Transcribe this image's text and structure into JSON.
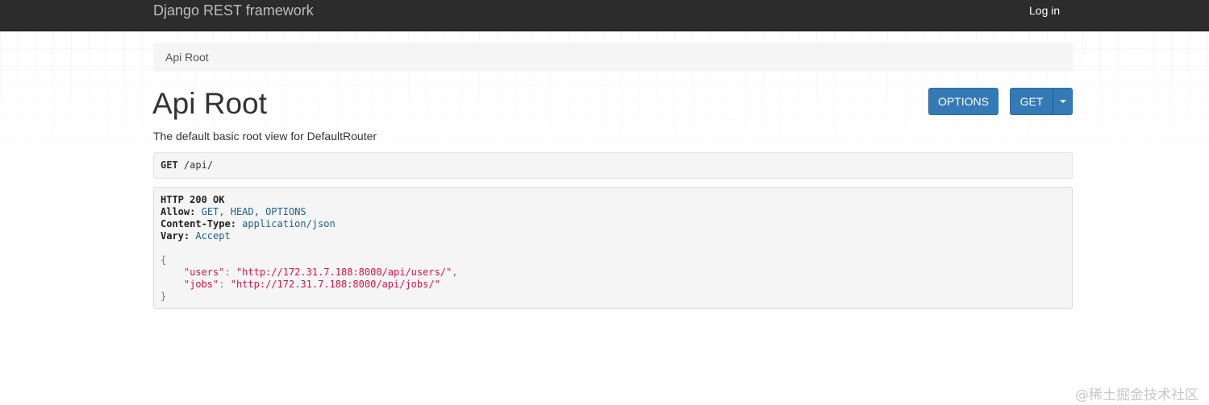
{
  "navbar": {
    "brand": "Django REST framework",
    "login_label": "Log in"
  },
  "breadcrumb": {
    "items": [
      "Api Root"
    ]
  },
  "page": {
    "title": "Api Root",
    "description": "The default basic root view for DefaultRouter"
  },
  "buttons": {
    "options_label": "OPTIONS",
    "get_label": "GET"
  },
  "request": {
    "method": "GET",
    "path": "/api/"
  },
  "response": {
    "status_line": "HTTP 200 OK",
    "headers": [
      {
        "key": "Allow:",
        "value": "GET, HEAD, OPTIONS"
      },
      {
        "key": "Content-Type:",
        "value": "application/json"
      },
      {
        "key": "Vary:",
        "value": "Accept"
      }
    ],
    "json_open": "{",
    "json_close": "}",
    "body": [
      {
        "key": "\"users\"",
        "value": "\"http://172.31.7.188:8000/api/users/\"",
        "trail": ","
      },
      {
        "key": "\"jobs\"",
        "value": "\"http://172.31.7.188:8000/api/jobs/\"",
        "trail": ""
      }
    ]
  },
  "watermark": "@稀土掘金技术社区",
  "colors": {
    "navbar_bg": "#2c2c2c",
    "primary_button": "#337ab7",
    "json_string": "#dd1144",
    "header_value": "#1f5f8b"
  }
}
